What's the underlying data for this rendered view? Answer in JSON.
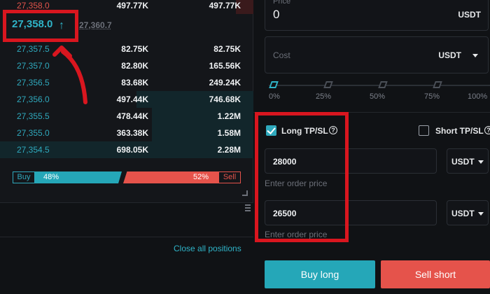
{
  "order_book": {
    "rows": [
      {
        "side": "ask",
        "price": "27,358.0",
        "amount": "497.77K",
        "total": "497.77K",
        "depth": 0.07
      },
      {
        "side": "bid",
        "price": "27,357.5",
        "amount": "82.75K",
        "total": "82.75K",
        "depth": 0.0
      },
      {
        "side": "bid",
        "price": "27,357.0",
        "amount": "82.80K",
        "total": "165.56K",
        "depth": 0.0
      },
      {
        "side": "bid",
        "price": "27,356.5",
        "amount": "83.68K",
        "total": "249.24K",
        "depth": 0.0
      },
      {
        "side": "bid",
        "price": "27,356.0",
        "amount": "497.44K",
        "total": "746.68K",
        "depth": 0.46
      },
      {
        "side": "bid",
        "price": "27,355.5",
        "amount": "478.44K",
        "total": "1.22M",
        "depth": 0.4
      },
      {
        "side": "bid",
        "price": "27,355.0",
        "amount": "363.38K",
        "total": "1.58M",
        "depth": 0.4
      },
      {
        "side": "bid",
        "price": "27,354.5",
        "amount": "698.05K",
        "total": "2.28M",
        "depth": 1.0
      }
    ],
    "last_price": "27,358.0",
    "last_price_arrow": "↑",
    "mark_price": "27,360.7",
    "ratio": {
      "buy_label": "Buy",
      "buy_pct": "48%",
      "buy_fraction": 0.48,
      "sell_label": "Sell",
      "sell_pct": "52%",
      "sell_fraction": 0.52
    }
  },
  "positions": {
    "close_all_label": "Close all positions"
  },
  "order_form": {
    "price": {
      "label": "Price",
      "value": "0",
      "unit": "USDT"
    },
    "cost": {
      "placeholder": "Cost",
      "unit": "USDT"
    },
    "slider": {
      "value_fraction": 0.0,
      "marks": [
        "0%",
        "25%",
        "50%",
        "75%",
        "100%"
      ]
    },
    "long_tpsl": {
      "label": "Long TP/SL",
      "checked": true
    },
    "short_tpsl": {
      "label": "Short TP/SL",
      "checked": false
    },
    "tp_input": {
      "value": "28000",
      "unit": "USDT",
      "hint": "Enter order price"
    },
    "sl_input": {
      "value": "26500",
      "unit": "USDT",
      "hint": "Enter order price"
    },
    "buy_long_label": "Buy long",
    "sell_short_label": "Sell short"
  },
  "colors": {
    "accent_teal": "#25a7b8",
    "sell_red": "#e5534b",
    "annotation_red": "#d9161f",
    "background": "#101215"
  }
}
